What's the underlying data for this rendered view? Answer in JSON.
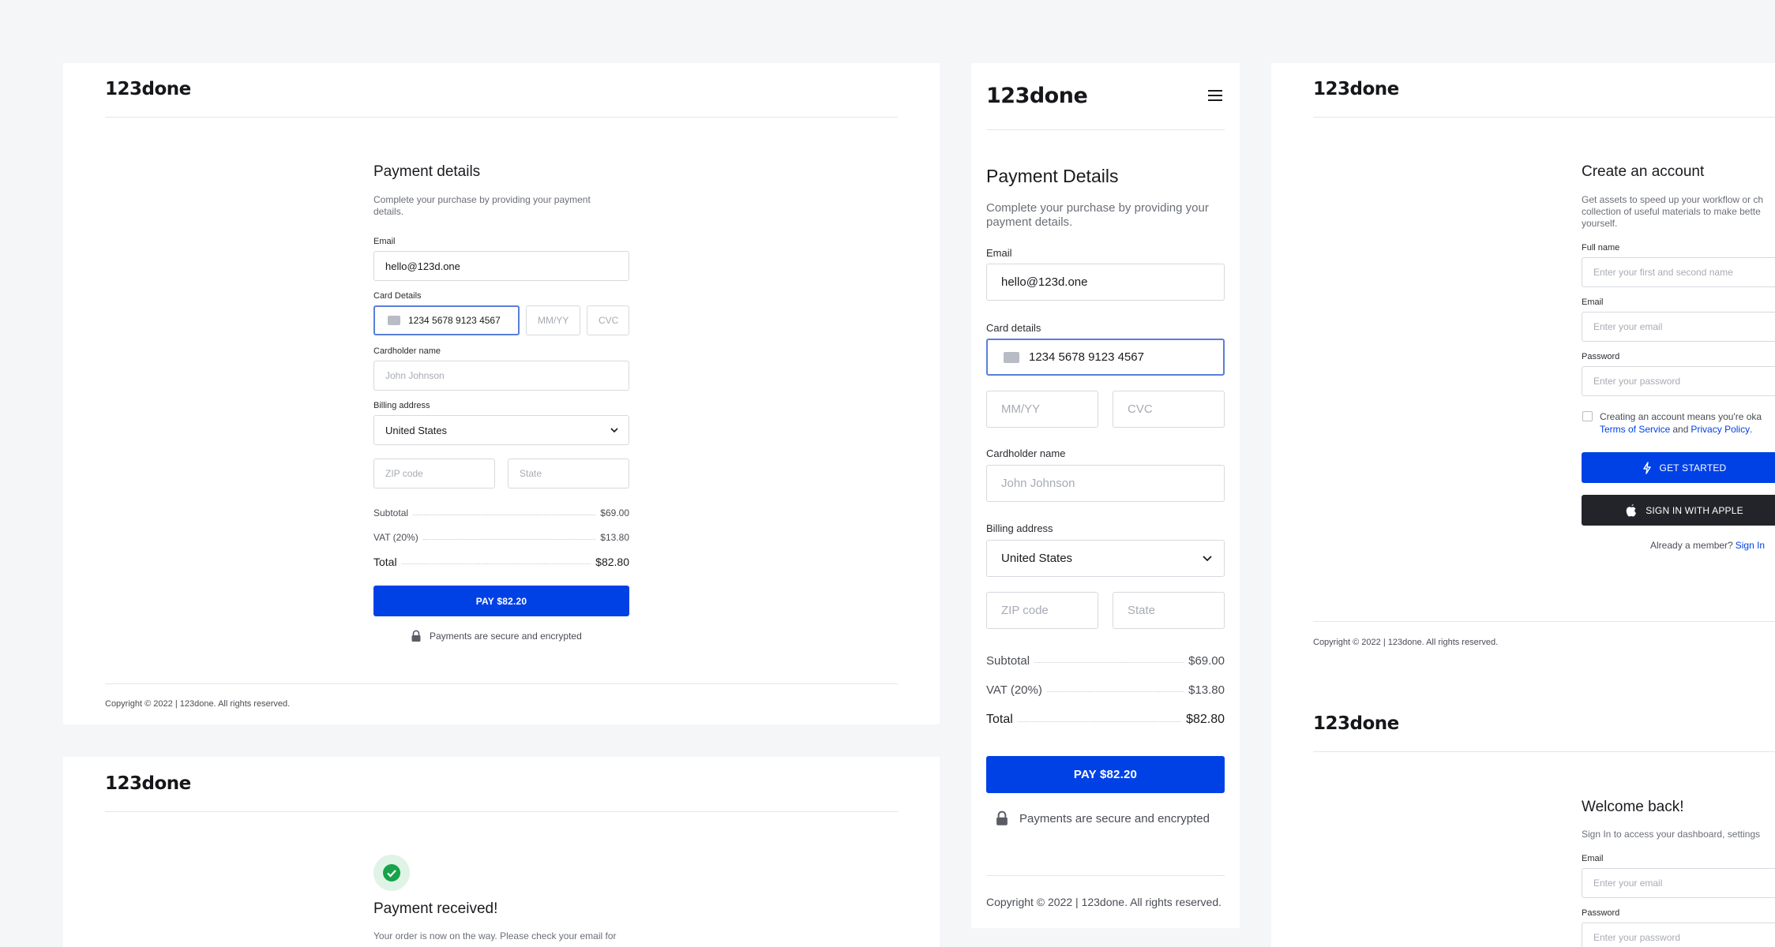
{
  "brand": {
    "logo": "123done",
    "accent": "#0041e6",
    "dark": "#23242a",
    "success": "#16a34a"
  },
  "payment_desktop": {
    "title": "Payment details",
    "subtitle_line1": "Complete your purchase by providing your payment",
    "subtitle_line2": "details.",
    "email_label": "Email",
    "email_value": "hello@123d.one",
    "card_label": "Card Details",
    "card_number": "1234  5678  9123  4567",
    "expiry_placeholder": "MM/YY",
    "cvc_placeholder": "CVC",
    "cardholder_label": "Cardholder name",
    "cardholder_placeholder": "John Johnson",
    "billing_label": "Billing address",
    "country": "United States",
    "zip_placeholder": "ZIP code",
    "state_placeholder": "State",
    "subtotal_label": "Subtotal",
    "subtotal_value": "$69.00",
    "vat_label": "VAT (20%)",
    "vat_value": "$13.80",
    "total_label": "Total",
    "total_value": "$82.80",
    "pay_button": "PAY $82.20",
    "secure_note": "Payments are secure and encrypted",
    "copyright": "Copyright © 2022 | 123done. All rights reserved."
  },
  "payment_received": {
    "title": "Payment received!",
    "message": "Your order is now on the way. Please check your email for"
  },
  "payment_mobile": {
    "title": "Payment Details",
    "subtitle_line1": "Complete your purchase by providing your",
    "subtitle_line2": "payment details.",
    "email_label": "Email",
    "email_value": "hello@123d.one",
    "card_label": "Card details",
    "card_number": "1234  5678  9123  4567",
    "expiry_placeholder": "MM/YY",
    "cvc_placeholder": "CVC",
    "cardholder_label": "Cardholder name",
    "cardholder_placeholder": "John Johnson",
    "billing_label": "Billing address",
    "country": "United States",
    "zip_placeholder": "ZIP code",
    "state_placeholder": "State",
    "subtotal_label": "Subtotal",
    "subtotal_value": "$69.00",
    "vat_label": "VAT (20%)",
    "vat_value": "$13.80",
    "total_label": "Total",
    "total_value": "$82.80",
    "pay_button": "PAY $82.20",
    "secure_note": "Payments are secure and encrypted",
    "copyright": "Copyright © 2022 | 123done. All rights reserved."
  },
  "signup": {
    "title": "Create an account",
    "subtitle_line1": "Get assets to speed up your workflow or ch",
    "subtitle_line2": "collection of useful materials to make bette",
    "subtitle_line3": "yourself.",
    "fullname_label": "Full name",
    "fullname_placeholder": "Enter your first and second name",
    "email_label": "Email",
    "email_placeholder": "Enter your email",
    "password_label": "Password",
    "password_placeholder": "Enter your password",
    "terms_text": "Creating an account means you're oka",
    "terms_link": "Terms of Service",
    "terms_and": "and",
    "privacy_link": "Privacy Policy",
    "terms_period": ".",
    "get_started": "GET STARTED",
    "apple_button": "SIGN IN WITH APPLE",
    "member_text": "Already a member?",
    "signin_link": "Sign In",
    "copyright": "Copyright © 2022 | 123done. All rights reserved."
  },
  "signin": {
    "title": "Welcome back!",
    "subtitle": "Sign In to access your dashboard, settings",
    "email_label": "Email",
    "email_placeholder": "Enter your email",
    "password_label": "Password",
    "password_placeholder": "Enter your password"
  }
}
